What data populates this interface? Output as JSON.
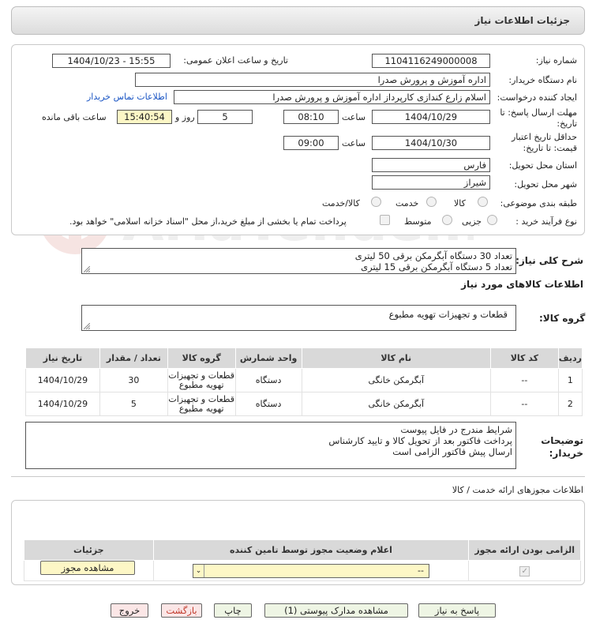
{
  "header": {
    "title": "جزئیات اطلاعات نیاز"
  },
  "fields": {
    "need_number_label": "شماره نیاز:",
    "need_number": "1104116249000008",
    "announce_label": "تاریخ و ساعت اعلان عمومی:",
    "announce_value": "1404/10/23 - 15:55",
    "buyer_label": "نام دستگاه خریدار:",
    "buyer_value": "اداره آموزش و پرورش صدرا",
    "creator_label": "ایجاد کننده درخواست:",
    "creator_value": "اسلام زارع کندازی کارپرداز اداره آموزش و پرورش صدرا",
    "contact_link": "اطلاعات تماس خریدار",
    "deadline_label": "مهلت ارسال پاسخ: تا تاریخ:",
    "deadline_date": "1404/10/29",
    "time_label": "ساعت",
    "deadline_time": "08:10",
    "days_value": "5",
    "days_label": "روز و",
    "remaining_time": "15:40:54",
    "remaining_label": "ساعت باقی مانده",
    "validity_label": "حداقل تاریخ اعتبار قیمت: تا تاریخ:",
    "validity_date": "1404/10/30",
    "validity_time": "09:00",
    "province_label": "استان محل تحویل:",
    "province_value": "فارس",
    "city_label": "شهر محل تحویل:",
    "city_value": "شیراز",
    "category_label": "طبقه بندی موضوعی:",
    "cat_goods": "کالا",
    "cat_service": "خدمت",
    "cat_goods_service": "کالا/خدمت",
    "process_label": "نوع فرآیند خرید :",
    "proc_partial": "جزیی",
    "proc_medium": "متوسط",
    "payment_note": "پرداخت تمام یا بخشی از مبلغ خرید،از محل \"اسناد خزانه اسلامی\" خواهد بود."
  },
  "description": {
    "label": "شرح کلی نیاز:",
    "line1": "تعداد 30 دستگاه آبگرمکن برقی 50 لیتری",
    "line2": "تعداد 5 دستگاه آبگرمکن برقی 15 لیتری"
  },
  "goods_info_title": "اطلاعات کالاهای مورد نیاز",
  "goods_group": {
    "label": "گروه کالا:",
    "value": "قطعات و تجهیزات تهویه مطبوع"
  },
  "goods_table": {
    "headers": [
      "ردیف",
      "کد کالا",
      "نام کالا",
      "واحد شمارش",
      "گروه کالا",
      "تعداد / مقدار",
      "تاریخ نیاز"
    ],
    "rows": [
      {
        "row": "1",
        "code": "--",
        "name": "آبگرمکن خانگی",
        "unit": "دستگاه",
        "group_line1": "قطعات و تجهیزات",
        "group_line2": "تهویه مطبوع",
        "qty": "30",
        "date": "1404/10/29"
      },
      {
        "row": "2",
        "code": "--",
        "name": "آبگرمکن خانگی",
        "unit": "دستگاه",
        "group_line1": "قطعات و تجهیزات",
        "group_line2": "تهویه مطبوع",
        "qty": "5",
        "date": "1404/10/29"
      }
    ]
  },
  "buyer_notes": {
    "label_line1": "توضیحات",
    "label_line2": "خریدار:",
    "line1": "شرایط مندرج در فایل پیوست",
    "line2": "پرداخت فاکتور بعد از تحویل کالا و تایید کارشناس",
    "line3": "ارسال پیش فاکتور الزامی است"
  },
  "permits": {
    "section_title": "اطلاعات مجوزهای ارائه خدمت / کالا",
    "headers": [
      "الزامی بودن ارائه مجوز",
      "اعلام وضعیت مجوز توسط تامین کننده",
      "جزئیات"
    ],
    "select_value": "--",
    "view_button": "مشاهده مجوز"
  },
  "buttons": {
    "reply": "پاسخ به نیاز",
    "docs": "مشاهده مدارک پیوستی (1)",
    "print": "چاپ",
    "back": "بازگشت",
    "exit": "خروج"
  },
  "watermark_text": "AriaTender.neT"
}
